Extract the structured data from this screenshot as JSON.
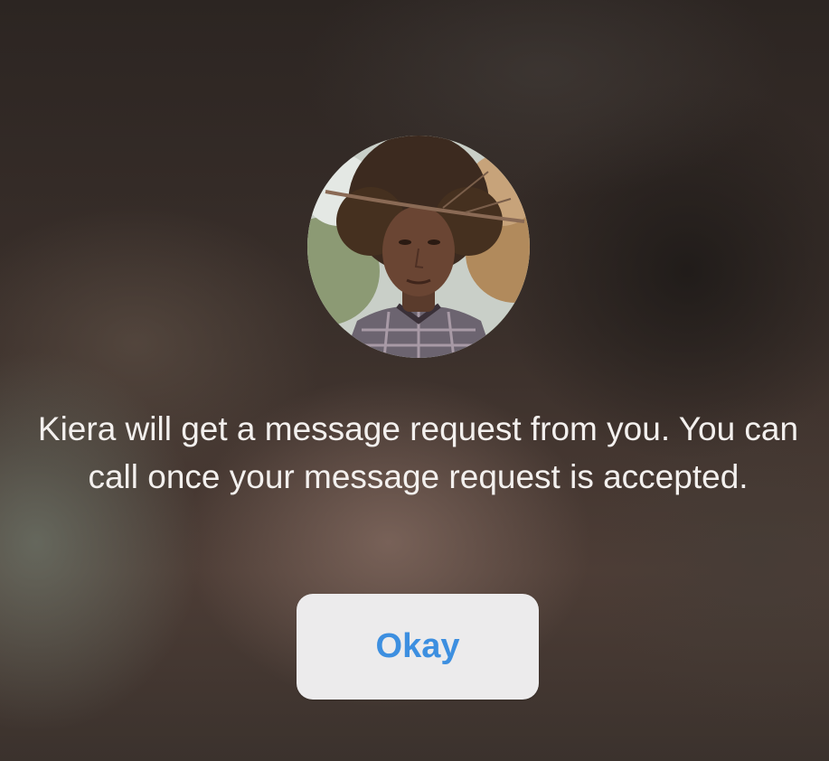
{
  "dialog": {
    "avatar_icon": "profile-photo",
    "message": "Kiera will get a message request from you. You can call once your message request is accepted.",
    "okay_label": "Okay"
  },
  "colors": {
    "button_text": "#3d8fe0",
    "button_background": "#ecebec",
    "message_text": "#f3f0ee"
  }
}
